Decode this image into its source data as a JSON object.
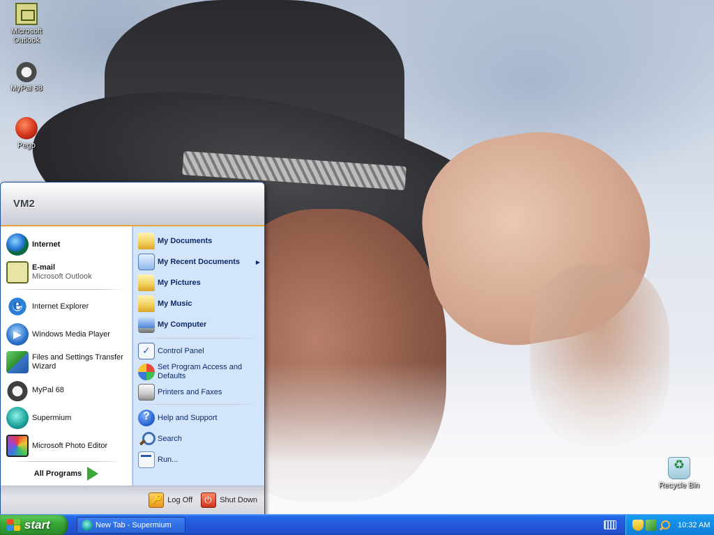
{
  "desktop": {
    "icons": [
      {
        "label": "Microsoft Outlook",
        "icon": "outlook-icon"
      },
      {
        "label": "MyPal 68",
        "icon": "mypal-icon"
      },
      {
        "label": "Pego",
        "icon": "pego-icon"
      },
      {
        "label": "Recycle Bin",
        "icon": "recycle-bin-icon"
      }
    ]
  },
  "start_menu": {
    "user": "VM2",
    "pinned": [
      {
        "label": "Internet",
        "icon": "internet-globe-icon"
      },
      {
        "label": "E-mail",
        "sublabel": "Microsoft Outlook",
        "icon": "email-outlook-icon"
      }
    ],
    "recent": [
      {
        "label": "Internet Explorer",
        "icon": "ie-icon"
      },
      {
        "label": "Windows Media Player",
        "icon": "media-player-icon"
      },
      {
        "label": "Files and Settings Transfer Wizard",
        "icon": "transfer-wizard-icon"
      },
      {
        "label": "MyPal 68",
        "icon": "mypal-icon"
      },
      {
        "label": "Supermium",
        "icon": "supermium-icon"
      },
      {
        "label": "Microsoft Photo Editor",
        "icon": "photo-editor-icon"
      }
    ],
    "all_programs": "All Programs",
    "places": [
      {
        "label": "My Documents",
        "icon": "folder-documents-icon"
      },
      {
        "label": "My Recent Documents",
        "icon": "recent-documents-icon"
      },
      {
        "label": "My Pictures",
        "icon": "folder-pictures-icon"
      },
      {
        "label": "My Music",
        "icon": "folder-music-icon"
      },
      {
        "label": "My Computer",
        "icon": "computer-icon"
      }
    ],
    "settings": [
      {
        "label": "Control Panel",
        "icon": "control-panel-icon"
      },
      {
        "label": "Set Program Access and Defaults",
        "icon": "program-access-icon"
      },
      {
        "label": "Printers and Faxes",
        "icon": "printer-icon"
      }
    ],
    "help": [
      {
        "label": "Help and Support",
        "icon": "help-icon"
      },
      {
        "label": "Search",
        "icon": "search-icon"
      },
      {
        "label": "Run...",
        "icon": "run-icon"
      }
    ],
    "footer": {
      "logoff": "Log Off",
      "shutdown": "Shut Down"
    }
  },
  "taskbar": {
    "start_label": "start",
    "tasks": [
      {
        "label": "New Tab - Supermium",
        "icon": "supermium-icon"
      }
    ],
    "clock": "10:32 AM"
  }
}
